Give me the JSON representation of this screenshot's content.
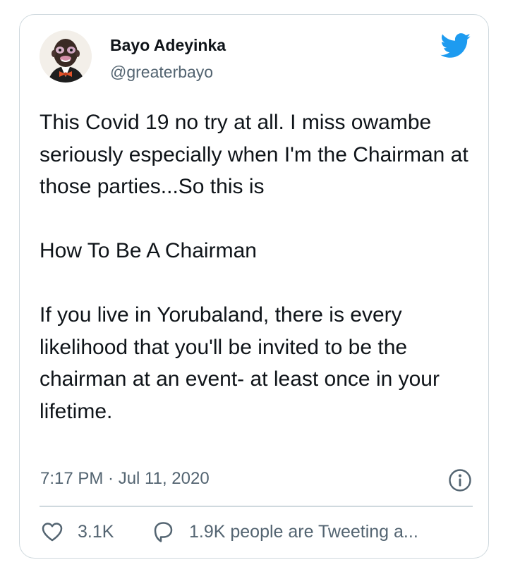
{
  "author": {
    "name": "Bayo Adeyinka",
    "handle": "@greaterbayo"
  },
  "icons": {
    "brand": "twitter-bird-icon",
    "info": "info-icon",
    "like": "heart-icon",
    "conversation": "speech-bubble-icon"
  },
  "tweet": {
    "paragraphs": [
      "This Covid 19 no try at all. I miss owambe seriously especially when I'm the Chairman at those parties...So this is",
      "How To Be A Chairman",
      "If you live in Yorubaland, there is every likelihood that you'll be invited to be the chairman at an event- at least once in your lifetime."
    ],
    "timestamp": "7:17 PM · Jul 11, 2020"
  },
  "actions": {
    "likes": "3.1K",
    "tweeting": "1.9K people are Tweeting a..."
  },
  "colors": {
    "brand_blue": "#1d9bf0",
    "text": "#0f1419",
    "secondary": "#536471",
    "border": "#cfd9de"
  }
}
